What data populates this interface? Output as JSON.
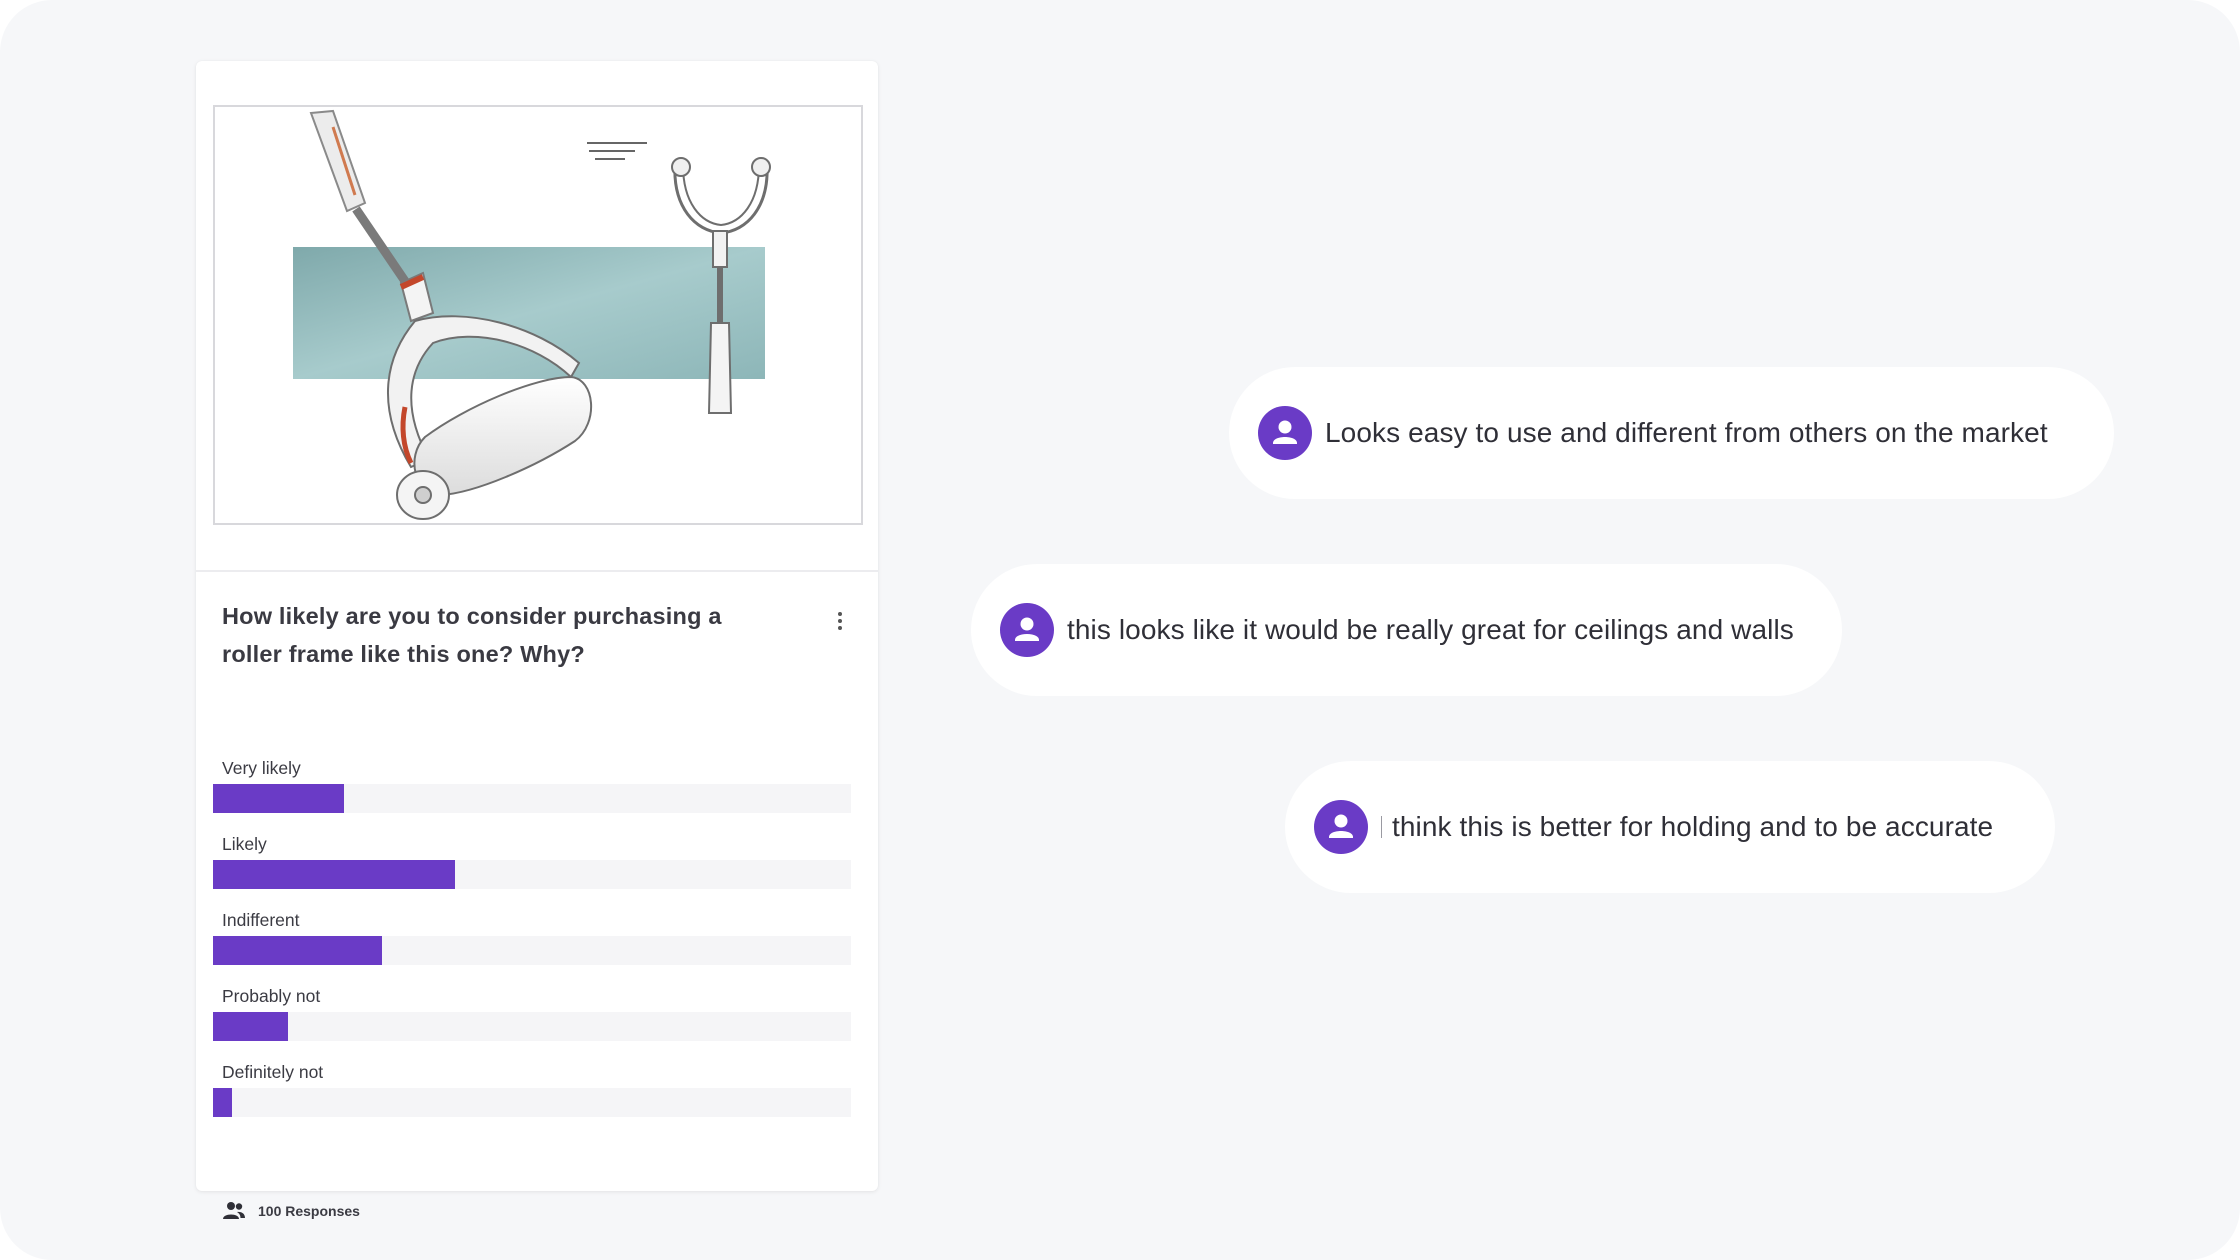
{
  "survey_card": {
    "image_alt": "roller frame product sketch",
    "question": "How likely are you to consider purchasing a roller frame like this one? Why?",
    "more_icon": "more-vertical-icon",
    "options": [
      {
        "label": "Very likely",
        "percent": 20.5
      },
      {
        "label": "Likely",
        "percent": 38
      },
      {
        "label": "Indifferent",
        "percent": 26.5
      },
      {
        "label": "Probably not",
        "percent": 11.8
      },
      {
        "label": "Definitely not",
        "percent": 3
      }
    ],
    "responses_label": "100 Responses",
    "responses_icon": "people-icon"
  },
  "comments": [
    {
      "text": "Looks easy to use and different from others on the market",
      "avatar_icon": "user-icon"
    },
    {
      "text": "this looks like it would be really great for ceilings and walls",
      "avatar_icon": "user-icon"
    },
    {
      "text": "think this is better for holding and to be accurate",
      "avatar_icon": "user-icon"
    }
  ],
  "colors": {
    "accent": "#6a3bc6",
    "bar_track": "#f5f5f7",
    "page_bg": "#f6f7f9",
    "card_bg": "#ffffff"
  }
}
